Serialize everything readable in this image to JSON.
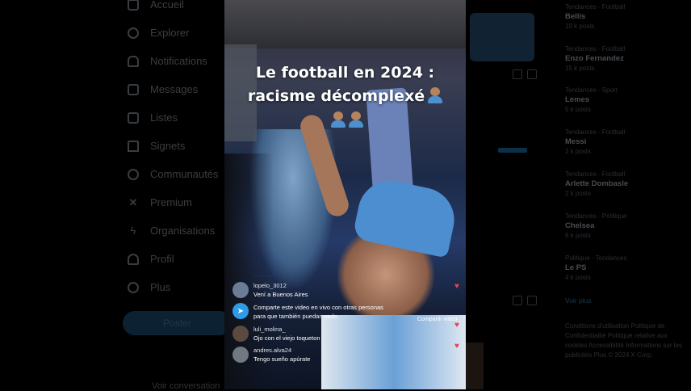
{
  "nav": {
    "items": [
      {
        "label": "Accueil",
        "icon": "home-icon"
      },
      {
        "label": "Explorer",
        "icon": "search-icon"
      },
      {
        "label": "Notifications",
        "icon": "bell-icon"
      },
      {
        "label": "Messages",
        "icon": "mail-icon"
      },
      {
        "label": "Listes",
        "icon": "list-icon"
      },
      {
        "label": "Signets",
        "icon": "bookmark-icon"
      },
      {
        "label": "Communautés",
        "icon": "people-icon"
      },
      {
        "label": "Premium",
        "icon": "x-logo-icon"
      },
      {
        "label": "Organisations",
        "icon": "lightning-icon"
      },
      {
        "label": "Profil",
        "icon": "user-icon"
      },
      {
        "label": "Plus",
        "icon": "more-icon"
      }
    ],
    "post_label": "Poster",
    "profile_snippet": "Voir conversation"
  },
  "video": {
    "headline_line1": "Le football en 2024 :",
    "headline_line2": "racisme décomplexé",
    "comments": [
      {
        "user": "lopelo_3012",
        "text": "Vení a Buenos Aires"
      },
      {
        "user": "luli_molina_",
        "text": "Ojo con el viejo toqueton"
      },
      {
        "user": "andres.alva24",
        "text": "Tengo sueño apúrate"
      }
    ],
    "share_prompt": "Comparte este video en vivo con otras personas para que también puedan verlo.",
    "share_button": "Compartir video"
  },
  "trends": [
    {
      "category": "Tendances · Football",
      "name": "Bellis",
      "count": "10 k posts"
    },
    {
      "category": "Tendances · Football",
      "name": "Enzo Fernandez",
      "count": "15 k posts"
    },
    {
      "category": "Tendances · Sport",
      "name": "Lemes",
      "count": "5 k posts"
    },
    {
      "category": "Tendances · Football",
      "name": "Messi",
      "count": "2 k posts"
    },
    {
      "category": "Tendances · Football",
      "name": "Arlette Dombasle",
      "count": "2 k posts"
    },
    {
      "category": "Tendances · Politique",
      "name": "Chelsea",
      "count": "6 k posts"
    },
    {
      "category": "Politique · Tendances",
      "name": "Le PS",
      "count": "4 k posts"
    }
  ],
  "show_more": "Voir plus",
  "footer": "Conditions d'utilisation  Politique de Confidentialité  Politique relative aux cookies  Accessibilité  Informations sur les publicités  Plus  © 2024 X Corp."
}
